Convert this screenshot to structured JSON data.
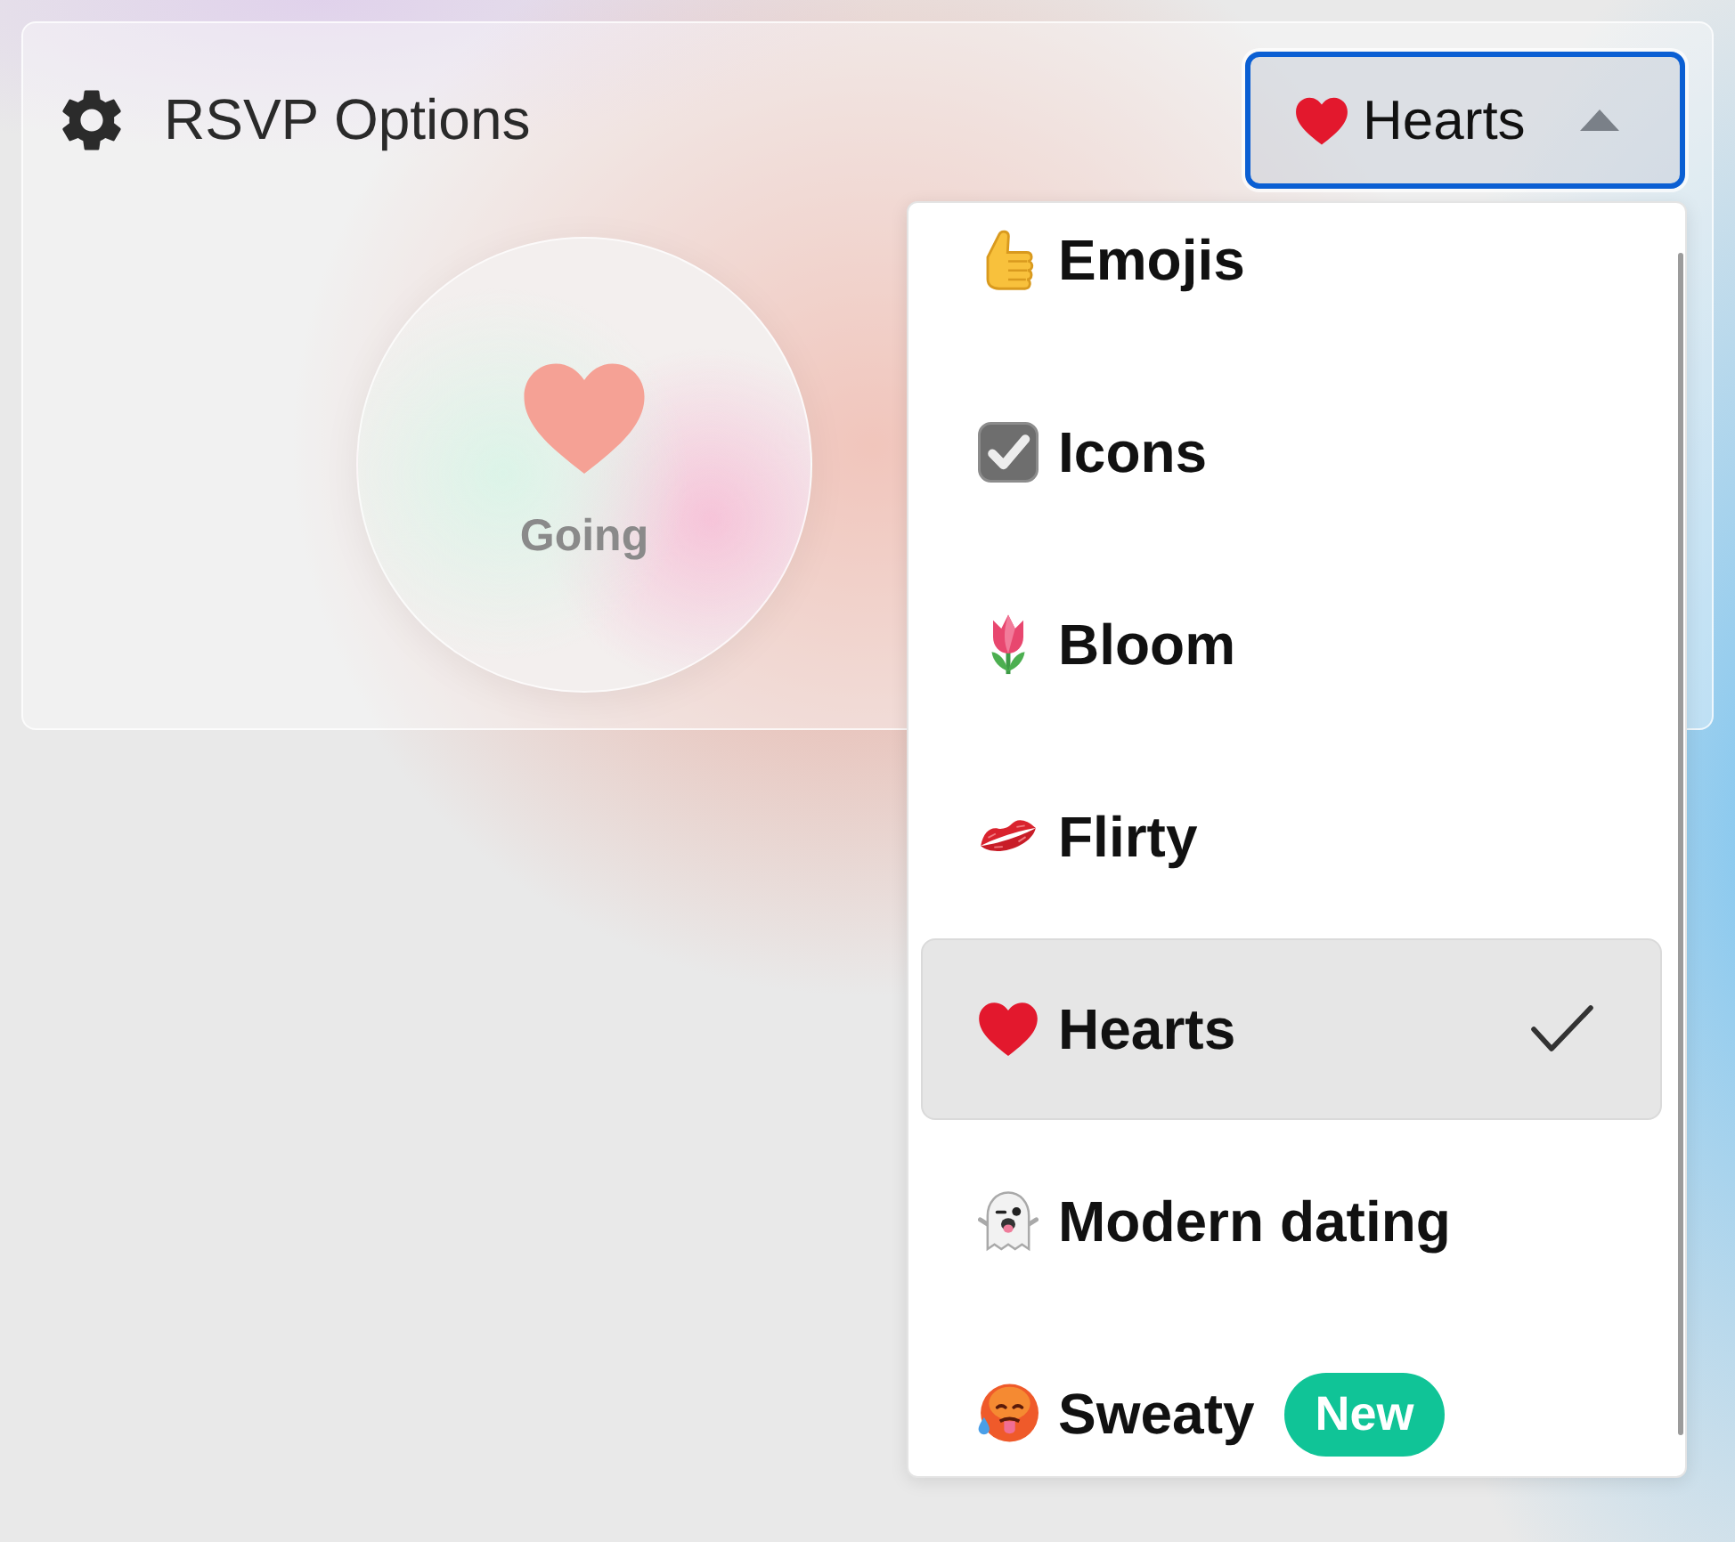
{
  "header": {
    "title": "RSVP Options"
  },
  "dropdown": {
    "value": "Hearts",
    "expanded": true
  },
  "rsvp_button": {
    "label": "Going"
  },
  "menu": {
    "items": [
      {
        "label": "Emojis",
        "selected": false
      },
      {
        "label": "Icons",
        "selected": false
      },
      {
        "label": "Bloom",
        "selected": false
      },
      {
        "label": "Flirty",
        "selected": false
      },
      {
        "label": "Hearts",
        "selected": true
      },
      {
        "label": "Modern dating",
        "selected": false
      },
      {
        "label": "Sweaty",
        "selected": false,
        "badge": "New"
      }
    ]
  }
}
